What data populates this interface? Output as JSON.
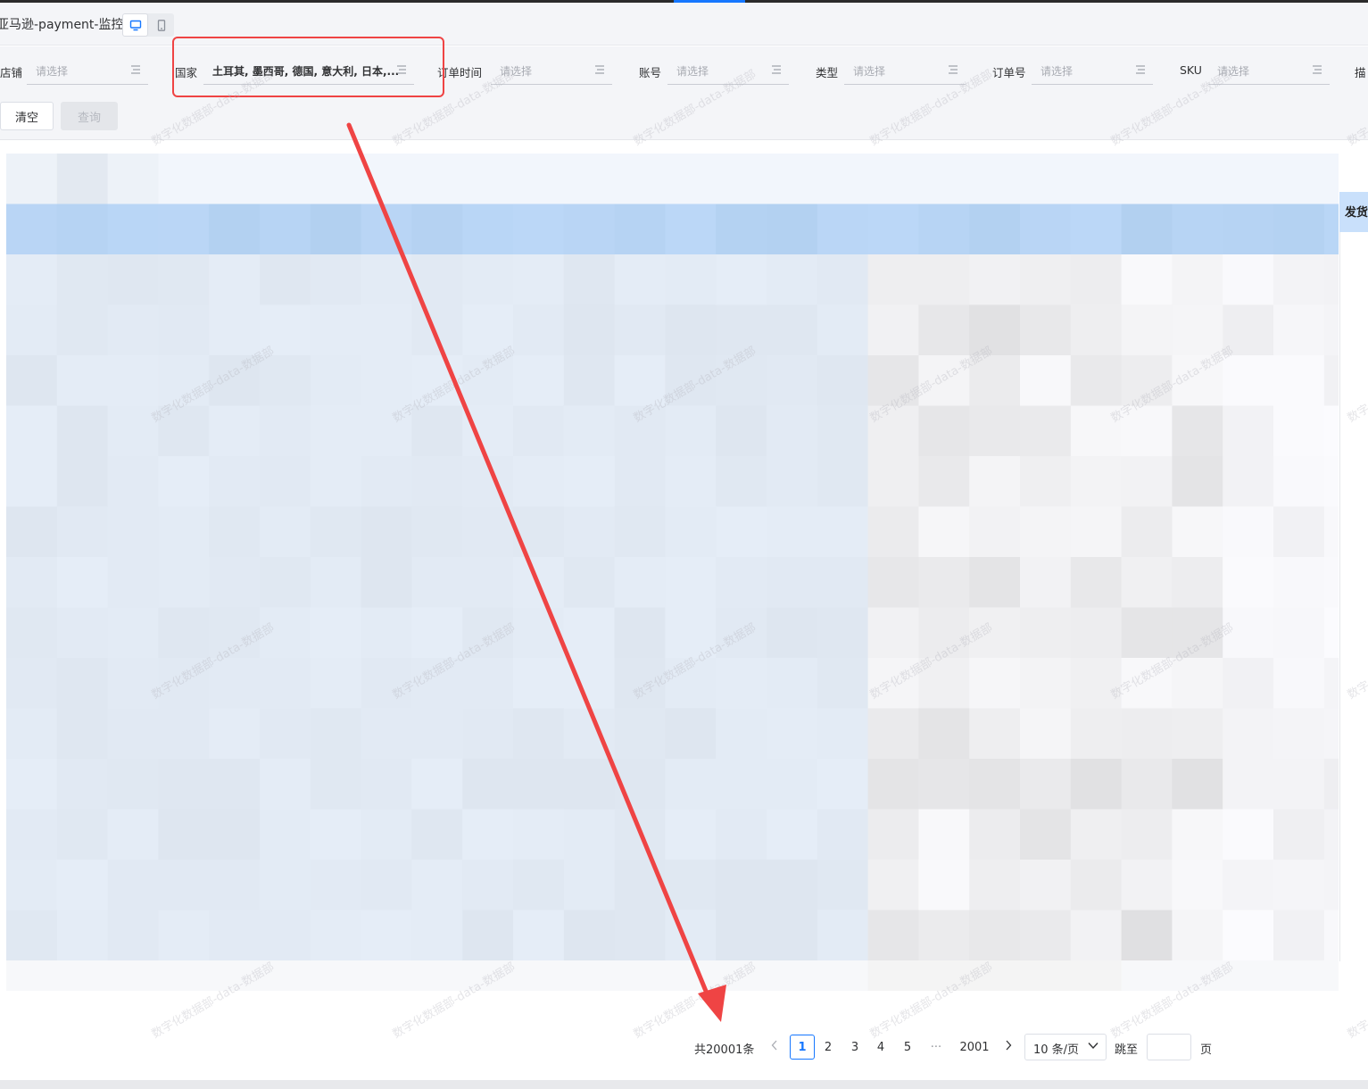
{
  "app": {
    "title": "亚马逊-payment-监控"
  },
  "view_toggle": {
    "desktop_icon": "monitor-icon",
    "mobile_icon": "phone-icon",
    "active": "desktop"
  },
  "filters": {
    "shop": {
      "label": "店铺",
      "placeholder": "请选择"
    },
    "country": {
      "label": "国家",
      "value": "土耳其, 墨西哥, 德国, 意大利, 日本,..."
    },
    "order_time": {
      "label": "订单时间",
      "placeholder": "请选择"
    },
    "account": {
      "label": "账号",
      "placeholder": "请选择"
    },
    "type": {
      "label": "类型",
      "placeholder": "请选择"
    },
    "order_no": {
      "label": "订单号",
      "placeholder": "请选择"
    },
    "sku": {
      "label": "SKU",
      "placeholder": "请选择"
    },
    "desc": {
      "label": "描"
    }
  },
  "actions": {
    "clear": "清空",
    "query": "查询"
  },
  "table": {
    "visible_header": "发货"
  },
  "watermark": "数字化数据部-data-数据部",
  "pagination": {
    "total": "共20001条",
    "pages": [
      "1",
      "2",
      "3",
      "4",
      "5"
    ],
    "ellipsis": "···",
    "last_page": "2001",
    "current": "1",
    "page_size": "10 条/页",
    "jump_label": "跳至",
    "jump_unit": "页"
  },
  "colors": {
    "accent": "#1677ff",
    "highlight": "#ef4444",
    "header_row": "#b8d8f8"
  }
}
